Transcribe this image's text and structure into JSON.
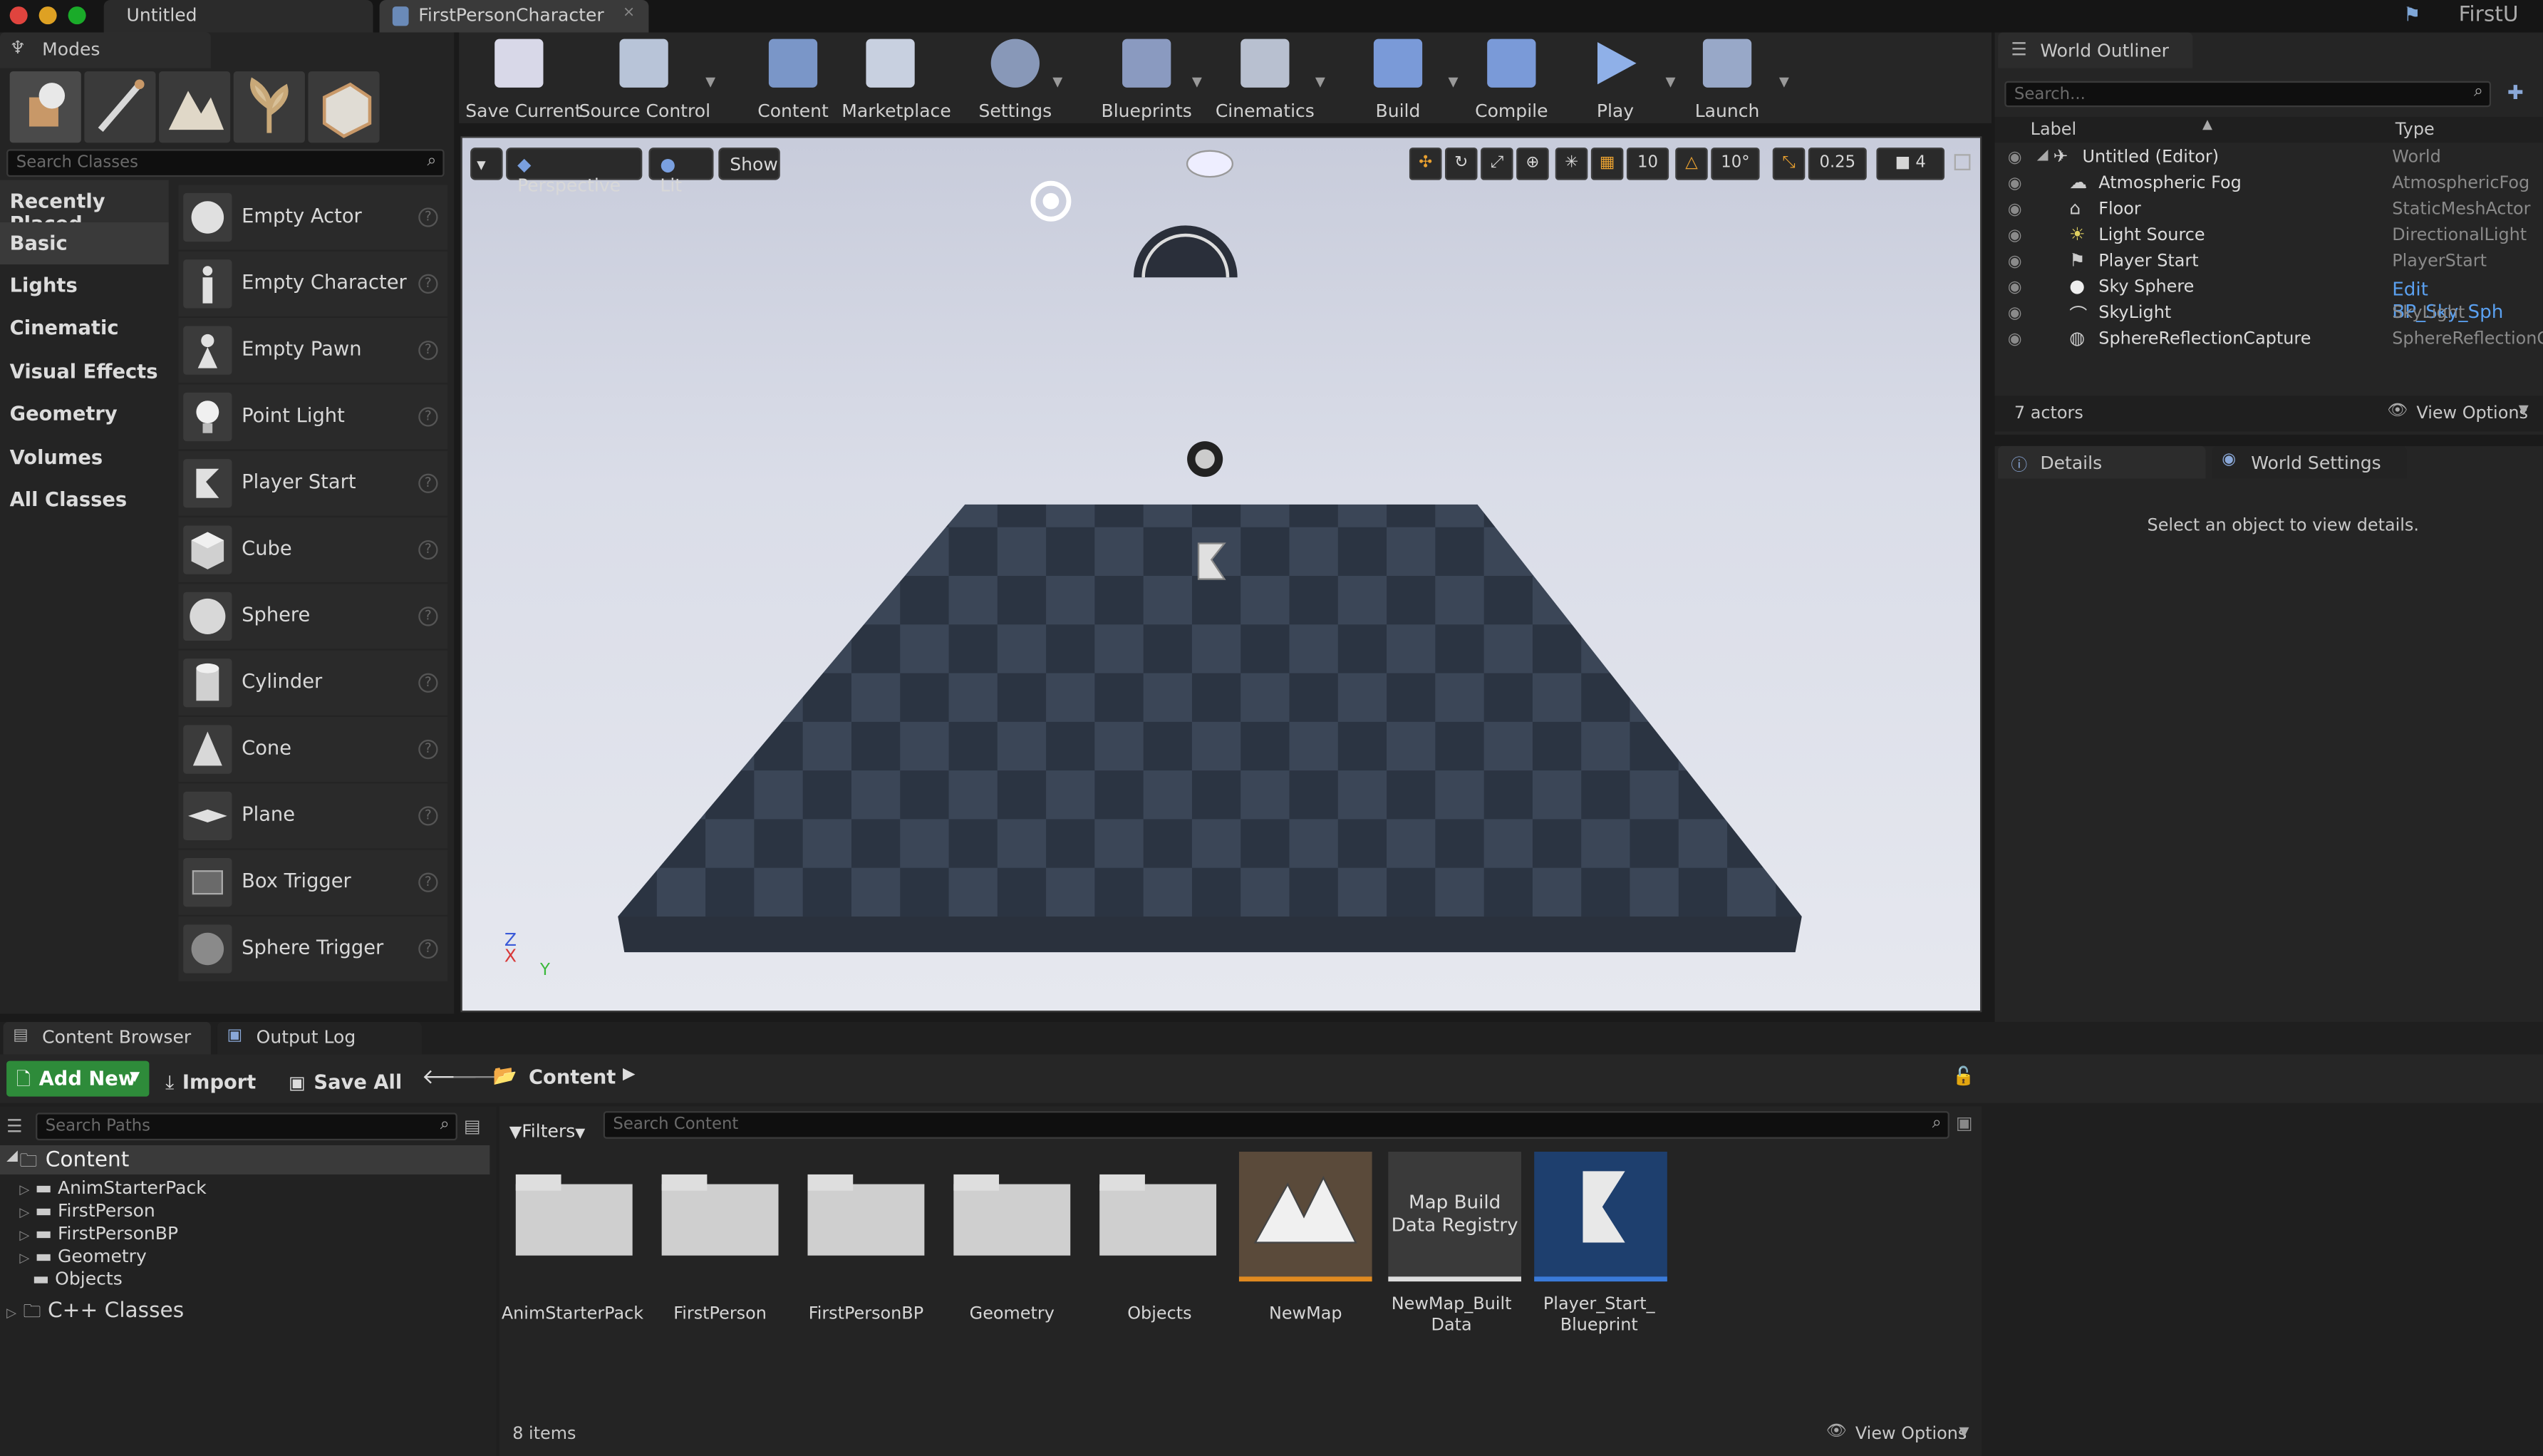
{
  "window": {
    "tabs": [
      "Untitled",
      "FirstPersonCharacter"
    ],
    "project_name": "FirstU"
  },
  "modes": {
    "title": "Modes",
    "search_placeholder": "Search Classes",
    "categories": [
      "Recently Placed",
      "Basic",
      "Lights",
      "Cinematic",
      "Visual Effects",
      "Geometry",
      "Volumes",
      "All Classes"
    ],
    "selected_category": "Basic",
    "classes": [
      "Empty Actor",
      "Empty Character",
      "Empty Pawn",
      "Point Light",
      "Player Start",
      "Cube",
      "Sphere",
      "Cylinder",
      "Cone",
      "Plane",
      "Box Trigger",
      "Sphere Trigger"
    ]
  },
  "toolbar": {
    "buttons": [
      "Save Current",
      "Source Control",
      "Content",
      "Marketplace",
      "Settings",
      "Blueprints",
      "Cinematics",
      "Build",
      "Compile",
      "Play",
      "Launch"
    ]
  },
  "viewport": {
    "perspective_label": "Perspective",
    "lit_label": "Lit",
    "show_label": "Show",
    "grid_snap": "10",
    "rotation_snap": "10°",
    "scale_snap": "0.25",
    "camera_speed": "4",
    "axis": {
      "z": "Z",
      "x": "X",
      "y": "Y"
    }
  },
  "outliner": {
    "title": "World Outliner",
    "search_placeholder": "Search...",
    "col_label": "Label",
    "col_type": "Type",
    "rows": [
      {
        "label": "Untitled (Editor)",
        "type": "World"
      },
      {
        "label": "Atmospheric Fog",
        "type": "AtmosphericFog"
      },
      {
        "label": "Floor",
        "type": "StaticMeshActor"
      },
      {
        "label": "Light Source",
        "type": "DirectionalLight"
      },
      {
        "label": "Player Start",
        "type": "PlayerStart"
      },
      {
        "label": "Sky Sphere",
        "type": "Edit BP_Sky_Sph"
      },
      {
        "label": "SkyLight",
        "type": "SkyLight"
      },
      {
        "label": "SphereReflectionCapture",
        "type": "SphereReflectionC"
      }
    ],
    "actor_count": "7 actors",
    "view_options": "View Options"
  },
  "details": {
    "tabs": [
      "Details",
      "World Settings"
    ],
    "empty_message": "Select an object to view details."
  },
  "content_browser": {
    "tabs": [
      "Content Browser",
      "Output Log"
    ],
    "add_new": "Add New",
    "import": "Import",
    "save_all": "Save All",
    "path": "Content",
    "search_paths_placeholder": "Search Paths",
    "filters": "Filters",
    "search_content_placeholder": "Search Content",
    "tree": [
      "Content",
      "AnimStarterPack",
      "FirstPerson",
      "FirstPersonBP",
      "Geometry",
      "Objects",
      "C++ Classes"
    ],
    "assets": [
      {
        "name": "AnimStarterPack",
        "kind": "folder"
      },
      {
        "name": "FirstPerson",
        "kind": "folder"
      },
      {
        "name": "FirstPersonBP",
        "kind": "folder"
      },
      {
        "name": "Geometry",
        "kind": "folder"
      },
      {
        "name": "Objects",
        "kind": "folder"
      },
      {
        "name": "NewMap",
        "kind": "map"
      },
      {
        "name": "NewMap_Built\nData",
        "kind": "registry",
        "thumb_text": "Map Build\nData Registry"
      },
      {
        "name": "Player_Start_\nBlueprint",
        "kind": "blueprint"
      }
    ],
    "item_count": "8 items",
    "view_options": "View Options"
  }
}
